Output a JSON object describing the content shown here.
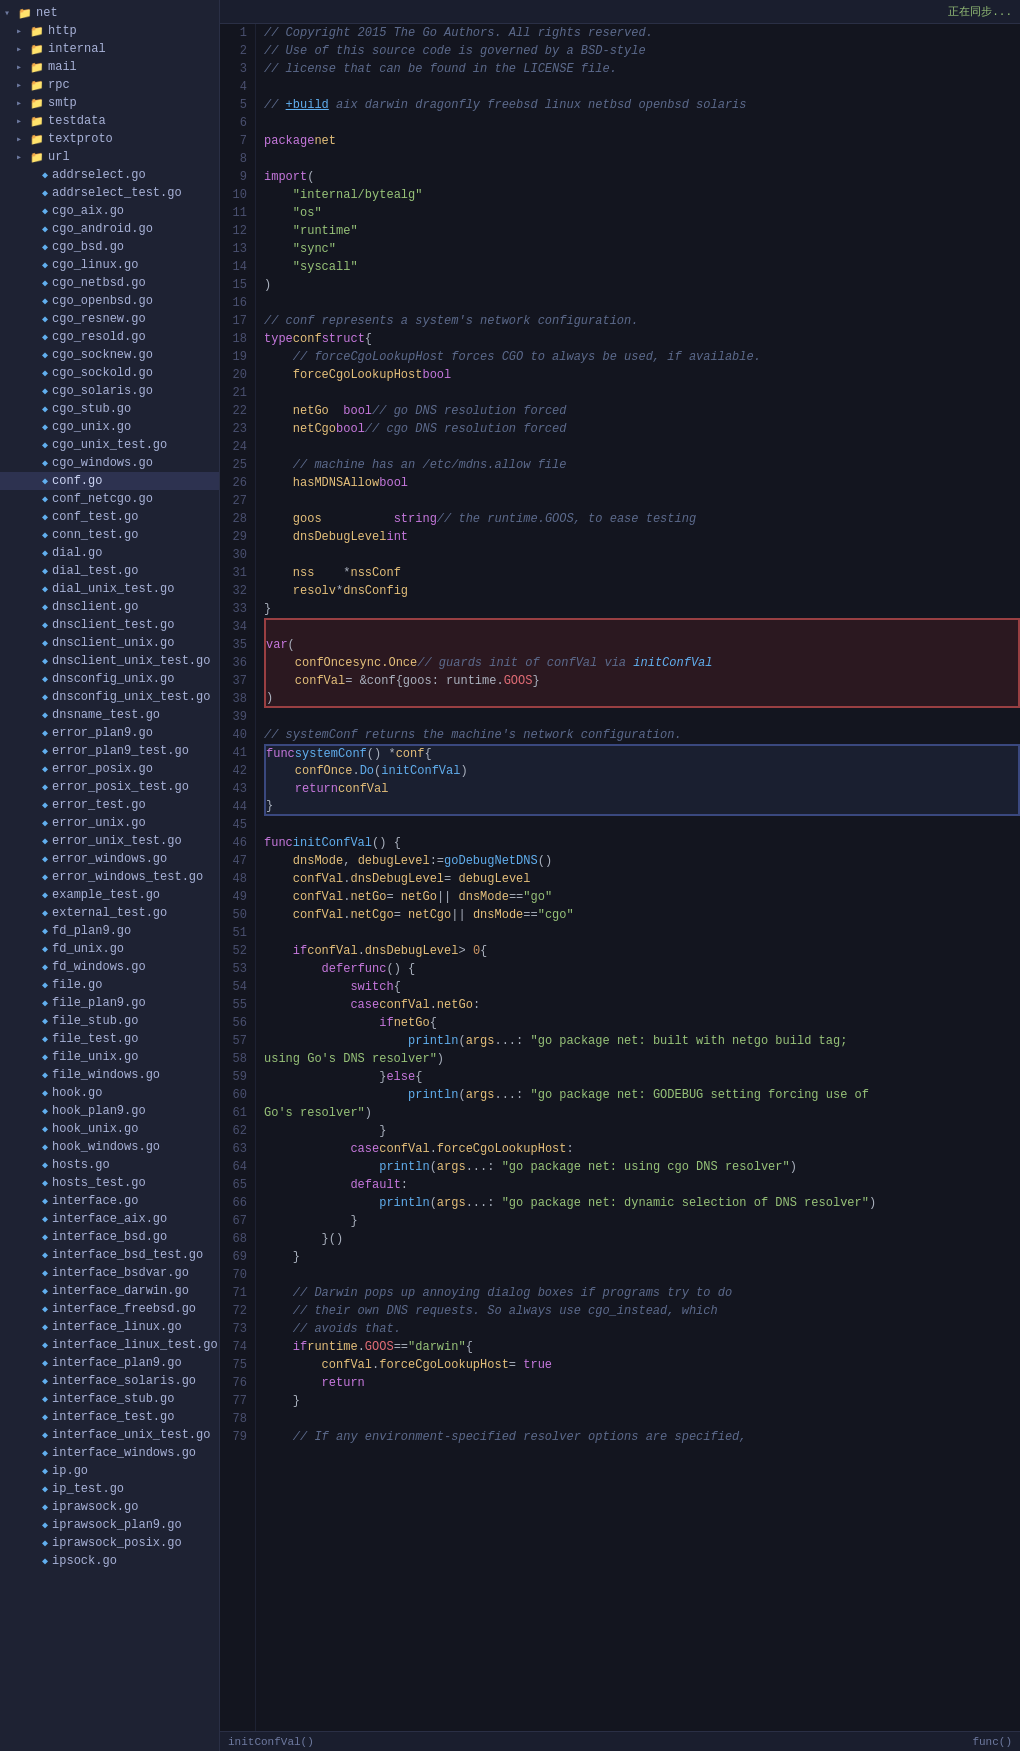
{
  "sidebar": {
    "title": "net",
    "sync_label": "正在同步...",
    "items": [
      {
        "id": "net-root",
        "label": "net",
        "type": "folder",
        "indent": 0,
        "expanded": true,
        "arrow": "▾"
      },
      {
        "id": "http",
        "label": "http",
        "type": "folder",
        "indent": 1,
        "expanded": false,
        "arrow": "▸"
      },
      {
        "id": "internal",
        "label": "internal",
        "type": "folder",
        "indent": 1,
        "expanded": false,
        "arrow": "▸"
      },
      {
        "id": "mail",
        "label": "mail",
        "type": "folder",
        "indent": 1,
        "expanded": false,
        "arrow": "▸"
      },
      {
        "id": "rpc",
        "label": "rpc",
        "type": "folder",
        "indent": 1,
        "expanded": false,
        "arrow": "▸"
      },
      {
        "id": "smtp",
        "label": "smtp",
        "type": "folder",
        "indent": 1,
        "expanded": false,
        "arrow": "▸"
      },
      {
        "id": "testdata",
        "label": "testdata",
        "type": "folder-orange",
        "indent": 1,
        "expanded": false,
        "arrow": "▸"
      },
      {
        "id": "textproto",
        "label": "textproto",
        "type": "folder",
        "indent": 1,
        "expanded": false,
        "arrow": "▸"
      },
      {
        "id": "url",
        "label": "url",
        "type": "folder",
        "indent": 1,
        "expanded": false,
        "arrow": "▸"
      },
      {
        "id": "addrselect.go",
        "label": "addrselect.go",
        "type": "go",
        "indent": 2
      },
      {
        "id": "addrselect_test.go",
        "label": "addrselect_test.go",
        "type": "go",
        "indent": 2
      },
      {
        "id": "cgo_aix.go",
        "label": "cgo_aix.go",
        "type": "go",
        "indent": 2
      },
      {
        "id": "cgo_android.go",
        "label": "cgo_android.go",
        "type": "go",
        "indent": 2
      },
      {
        "id": "cgo_bsd.go",
        "label": "cgo_bsd.go",
        "type": "go",
        "indent": 2
      },
      {
        "id": "cgo_linux.go",
        "label": "cgo_linux.go",
        "type": "go",
        "indent": 2
      },
      {
        "id": "cgo_netbsd.go",
        "label": "cgo_netbsd.go",
        "type": "go",
        "indent": 2
      },
      {
        "id": "cgo_openbsd.go",
        "label": "cgo_openbsd.go",
        "type": "go",
        "indent": 2
      },
      {
        "id": "cgo_resnew.go",
        "label": "cgo_resnew.go",
        "type": "go",
        "indent": 2
      },
      {
        "id": "cgo_resold.go",
        "label": "cgo_resold.go",
        "type": "go",
        "indent": 2
      },
      {
        "id": "cgo_socknew.go",
        "label": "cgo_socknew.go",
        "type": "go",
        "indent": 2
      },
      {
        "id": "cgo_sockold.go",
        "label": "cgo_sockold.go",
        "type": "go",
        "indent": 2
      },
      {
        "id": "cgo_solaris.go",
        "label": "cgo_solaris.go",
        "type": "go",
        "indent": 2
      },
      {
        "id": "cgo_stub.go",
        "label": "cgo_stub.go",
        "type": "go",
        "indent": 2
      },
      {
        "id": "cgo_unix.go",
        "label": "cgo_unix.go",
        "type": "go",
        "indent": 2
      },
      {
        "id": "cgo_unix_test.go",
        "label": "cgo_unix_test.go",
        "type": "go",
        "indent": 2
      },
      {
        "id": "cgo_windows.go",
        "label": "cgo_windows.go",
        "type": "go",
        "indent": 2
      },
      {
        "id": "conf.go",
        "label": "conf.go",
        "type": "go",
        "indent": 2,
        "active": true
      },
      {
        "id": "conf_netcgo.go",
        "label": "conf_netcgo.go",
        "type": "go",
        "indent": 2
      },
      {
        "id": "conf_test.go",
        "label": "conf_test.go",
        "type": "go",
        "indent": 2
      },
      {
        "id": "conn_test.go",
        "label": "conn_test.go",
        "type": "go",
        "indent": 2
      },
      {
        "id": "dial.go",
        "label": "dial.go",
        "type": "go",
        "indent": 2
      },
      {
        "id": "dial_test.go",
        "label": "dial_test.go",
        "type": "go",
        "indent": 2
      },
      {
        "id": "dial_unix_test.go",
        "label": "dial_unix_test.go",
        "type": "go",
        "indent": 2
      },
      {
        "id": "dnsclient.go",
        "label": "dnsclient.go",
        "type": "go",
        "indent": 2
      },
      {
        "id": "dnsclient_test.go",
        "label": "dnsclient_test.go",
        "type": "go",
        "indent": 2
      },
      {
        "id": "dnsclient_unix.go",
        "label": "dnsclient_unix.go",
        "type": "go",
        "indent": 2
      },
      {
        "id": "dnsclient_unix_test.go",
        "label": "dnsclient_unix_test.go",
        "type": "go",
        "indent": 2
      },
      {
        "id": "dnsconfig_unix.go",
        "label": "dnsconfig_unix.go",
        "type": "go",
        "indent": 2
      },
      {
        "id": "dnsconfig_unix_test.go",
        "label": "dnsconfig_unix_test.go",
        "type": "go",
        "indent": 2
      },
      {
        "id": "dnsname_test.go",
        "label": "dnsname_test.go",
        "type": "go",
        "indent": 2
      },
      {
        "id": "error_plan9.go",
        "label": "error_plan9.go",
        "type": "go",
        "indent": 2
      },
      {
        "id": "error_plan9_test.go",
        "label": "error_plan9_test.go",
        "type": "go",
        "indent": 2
      },
      {
        "id": "error_posix.go",
        "label": "error_posix.go",
        "type": "go",
        "indent": 2
      },
      {
        "id": "error_posix_test.go",
        "label": "error_posix_test.go",
        "type": "go",
        "indent": 2
      },
      {
        "id": "error_test.go",
        "label": "error_test.go",
        "type": "go",
        "indent": 2
      },
      {
        "id": "error_unix.go",
        "label": "error_unix.go",
        "type": "go",
        "indent": 2
      },
      {
        "id": "error_unix_test.go",
        "label": "error_unix_test.go",
        "type": "go",
        "indent": 2
      },
      {
        "id": "error_windows.go",
        "label": "error_windows.go",
        "type": "go",
        "indent": 2
      },
      {
        "id": "error_windows_test.go",
        "label": "error_windows_test.go",
        "type": "go",
        "indent": 2
      },
      {
        "id": "example_test.go",
        "label": "example_test.go",
        "type": "go",
        "indent": 2
      },
      {
        "id": "external_test.go",
        "label": "external_test.go",
        "type": "go",
        "indent": 2
      },
      {
        "id": "fd_plan9.go",
        "label": "fd_plan9.go",
        "type": "go",
        "indent": 2
      },
      {
        "id": "fd_unix.go",
        "label": "fd_unix.go",
        "type": "go",
        "indent": 2
      },
      {
        "id": "fd_windows.go",
        "label": "fd_windows.go",
        "type": "go",
        "indent": 2
      },
      {
        "id": "file.go",
        "label": "file.go",
        "type": "go",
        "indent": 2
      },
      {
        "id": "file_plan9.go",
        "label": "file_plan9.go",
        "type": "go",
        "indent": 2
      },
      {
        "id": "file_stub.go",
        "label": "file_stub.go",
        "type": "go",
        "indent": 2
      },
      {
        "id": "file_test.go",
        "label": "file_test.go",
        "type": "go",
        "indent": 2
      },
      {
        "id": "file_unix.go",
        "label": "file_unix.go",
        "type": "go",
        "indent": 2
      },
      {
        "id": "file_windows.go",
        "label": "file_windows.go",
        "type": "go",
        "indent": 2
      },
      {
        "id": "hook.go",
        "label": "hook.go",
        "type": "go",
        "indent": 2
      },
      {
        "id": "hook_plan9.go",
        "label": "hook_plan9.go",
        "type": "go",
        "indent": 2
      },
      {
        "id": "hook_unix.go",
        "label": "hook_unix.go",
        "type": "go",
        "indent": 2
      },
      {
        "id": "hook_windows.go",
        "label": "hook_windows.go",
        "type": "go",
        "indent": 2
      },
      {
        "id": "hosts.go",
        "label": "hosts.go",
        "type": "go",
        "indent": 2
      },
      {
        "id": "hosts_test.go",
        "label": "hosts_test.go",
        "type": "go",
        "indent": 2
      },
      {
        "id": "interface.go",
        "label": "interface.go",
        "type": "go",
        "indent": 2
      },
      {
        "id": "interface_aix.go",
        "label": "interface_aix.go",
        "type": "go",
        "indent": 2
      },
      {
        "id": "interface_bsd.go",
        "label": "interface_bsd.go",
        "type": "go",
        "indent": 2
      },
      {
        "id": "interface_bsd_test.go",
        "label": "interface_bsd_test.go",
        "type": "go",
        "indent": 2
      },
      {
        "id": "interface_bsdvar.go",
        "label": "interface_bsdvar.go",
        "type": "go",
        "indent": 2
      },
      {
        "id": "interface_darwin.go",
        "label": "interface_darwin.go",
        "type": "go",
        "indent": 2
      },
      {
        "id": "interface_freebsd.go",
        "label": "interface_freebsd.go",
        "type": "go",
        "indent": 2
      },
      {
        "id": "interface_linux.go",
        "label": "interface_linux.go",
        "type": "go",
        "indent": 2
      },
      {
        "id": "interface_linux_test.go",
        "label": "interface_linux_test.go",
        "type": "go",
        "indent": 2
      },
      {
        "id": "interface_plan9.go",
        "label": "interface_plan9.go",
        "type": "go",
        "indent": 2
      },
      {
        "id": "interface_solaris.go",
        "label": "interface_solaris.go",
        "type": "go",
        "indent": 2
      },
      {
        "id": "interface_stub.go",
        "label": "interface_stub.go",
        "type": "go",
        "indent": 2
      },
      {
        "id": "interface_test.go",
        "label": "interface_test.go",
        "type": "go",
        "indent": 2
      },
      {
        "id": "interface_unix_test.go",
        "label": "interface_unix_test.go",
        "type": "go",
        "indent": 2
      },
      {
        "id": "interface_windows.go",
        "label": "interface_windows.go",
        "type": "go",
        "indent": 2
      },
      {
        "id": "ip.go",
        "label": "ip.go",
        "type": "go",
        "indent": 2
      },
      {
        "id": "ip_test.go",
        "label": "ip_test.go",
        "type": "go",
        "indent": 2
      },
      {
        "id": "iprawsock.go",
        "label": "iprawsock.go",
        "type": "go",
        "indent": 2
      },
      {
        "id": "iprawsock_plan9.go",
        "label": "iprawsock_plan9.go",
        "type": "go",
        "indent": 2
      },
      {
        "id": "iprawsock_posix.go",
        "label": "iprawsock_posix.go",
        "type": "go",
        "indent": 2
      },
      {
        "id": "ipsock.go",
        "label": "ipsock.go",
        "type": "go",
        "indent": 2
      }
    ]
  },
  "editor": {
    "sync_label": "正在同步...",
    "filename": "conf.go"
  },
  "status_bar": {
    "left": "initConfVal()",
    "right": "func()"
  }
}
